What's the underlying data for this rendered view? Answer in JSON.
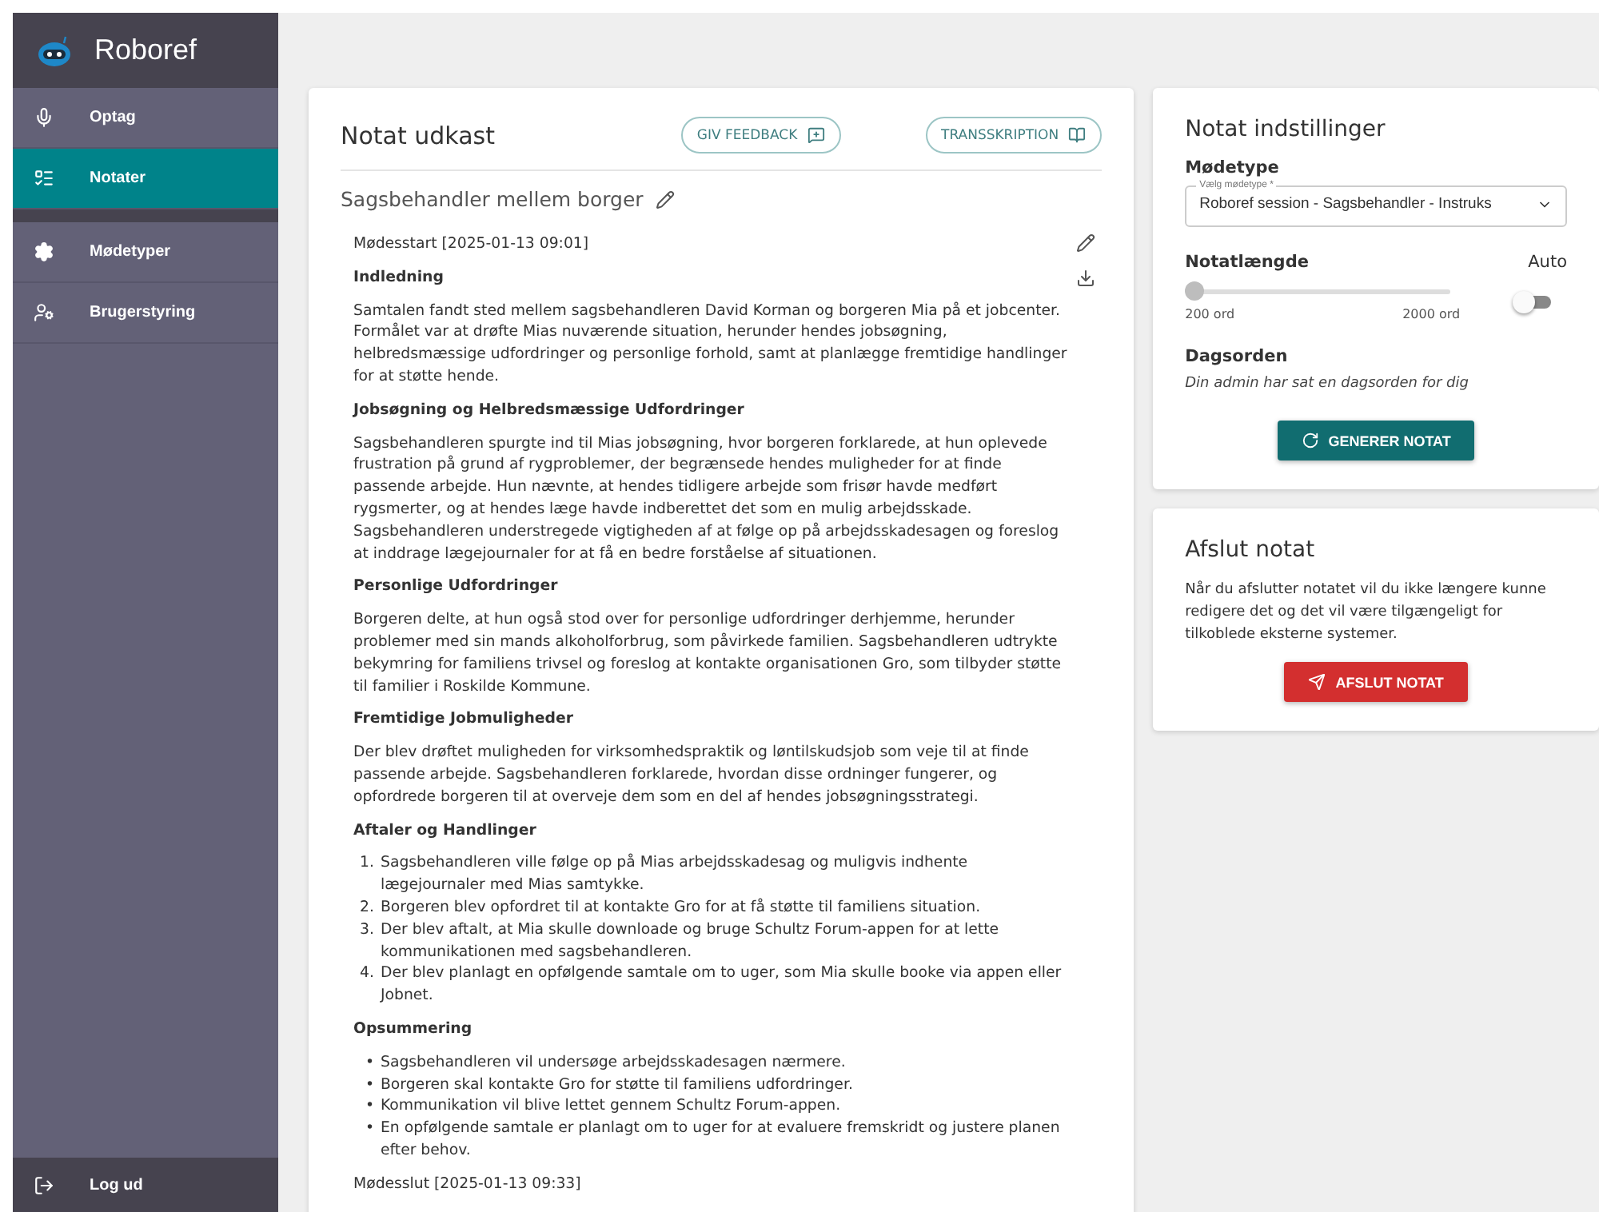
{
  "app": {
    "name": "Roboref"
  },
  "nav": [
    {
      "label": "Optag",
      "selected": false
    },
    {
      "label": "Notater",
      "selected": true
    },
    {
      "label": "Mødetyper",
      "selected": false
    },
    {
      "label": "Brugerstyring",
      "selected": false
    }
  ],
  "logout": {
    "label": "Log ud"
  },
  "note": {
    "title": "Notat udkast",
    "feedback_button": "GIV FEEDBACK",
    "transcript_button": "TRANSSKRIPTION",
    "subtitle": "Sagsbehandler mellem borger",
    "blocks": [
      {
        "kind": "timestamp",
        "text": "Mødesstart [2025-01-13 09:01]"
      },
      {
        "kind": "heading",
        "text": "Indledning"
      },
      {
        "kind": "paragraph",
        "text": "Samtalen fandt sted mellem sagsbehandleren David Korman og borgeren Mia på et jobcenter. Formålet var at drøfte Mias nuværende situation, herunder hendes jobsøgning, helbredsmæssige udfordringer og personlige forhold, samt at planlægge fremtidige handlinger for at støtte hende."
      },
      {
        "kind": "heading",
        "text": "Jobsøgning og Helbredsmæssige Udfordringer"
      },
      {
        "kind": "paragraph",
        "text": "Sagsbehandleren spurgte ind til Mias jobsøgning, hvor borgeren forklarede, at hun oplevede frustration på grund af rygproblemer, der begrænsede hendes muligheder for at finde passende arbejde. Hun nævnte, at hendes tidligere arbejde som frisør havde medført rygsmerter, og at hendes læge havde indberettet det som en mulig arbejdsskade. Sagsbehandleren understregede vigtigheden af at følge op på arbejdsskadesagen og foreslog at inddrage lægejournaler for at få en bedre forståelse af situationen."
      },
      {
        "kind": "heading",
        "text": "Personlige Udfordringer"
      },
      {
        "kind": "paragraph",
        "text": "Borgeren delte, at hun også stod over for personlige udfordringer derhjemme, herunder problemer med sin mands alkoholforbrug, som påvirkede familien. Sagsbehandleren udtrykte bekymring for familiens trivsel og foreslog at kontakte organisationen Gro, som tilbyder støtte til familier i Roskilde Kommune."
      },
      {
        "kind": "heading",
        "text": "Fremtidige Jobmuligheder"
      },
      {
        "kind": "paragraph",
        "text": "Der blev drøftet muligheden for virksomhedspraktik og løntilskudsjob som veje til at finde passende arbejde. Sagsbehandleren forklarede, hvordan disse ordninger fungerer, og opfordrede borgeren til at overveje dem som en del af hendes jobsøgningsstrategi."
      },
      {
        "kind": "heading",
        "text": "Aftaler og Handlinger"
      },
      {
        "kind": "ordered",
        "items": [
          {
            "marker": "1.",
            "text": "Sagsbehandleren ville følge op på Mias arbejdsskadesag og muligvis indhente lægejournaler med Mias samtykke."
          },
          {
            "marker": "2.",
            "text": "Borgeren blev opfordret til at kontakte Gro for at få støtte til familiens situation."
          },
          {
            "marker": "3.",
            "text": "Der blev aftalt, at Mia skulle downloade og bruge Schultz Forum-appen for at lette kommunikationen med sagsbehandleren."
          },
          {
            "marker": "4.",
            "text": "Der blev planlagt en opfølgende samtale om to uger, som Mia skulle booke via appen eller Jobnet."
          }
        ]
      },
      {
        "kind": "heading",
        "text": "Opsummering"
      },
      {
        "kind": "bullets",
        "items": [
          {
            "marker": "•",
            "text": "Sagsbehandleren vil undersøge arbejdsskadesagen nærmere."
          },
          {
            "marker": "•",
            "text": "Borgeren skal kontakte Gro for støtte til familiens udfordringer."
          },
          {
            "marker": "•",
            "text": "Kommunikation vil blive lettet gennem Schultz Forum-appen."
          },
          {
            "marker": "•",
            "text": "En opfølgende samtale er planlagt om to uger for at evaluere fremskridt og justere planen efter behov."
          }
        ]
      },
      {
        "kind": "timestamp",
        "text": "Mødesslut [2025-01-13 09:33]"
      }
    ]
  },
  "settings": {
    "title": "Notat indstillinger",
    "meeting_type_label": "Mødetype",
    "select": {
      "label": "Vælg mødetype *",
      "value": "Roboref session - Sagsbehandler - Instruks"
    },
    "length_label": "Notatlængde",
    "auto_label": "Auto",
    "auto": {
      "on": false
    },
    "slider": {
      "level": 0,
      "min_label": "200 ord",
      "max_label": "2000 ord"
    },
    "agenda_label": "Dagsorden",
    "agenda_text": "Din admin har sat en dagsorden for dig",
    "generate_button": "GENERER NOTAT"
  },
  "finish": {
    "title": "Afslut notat",
    "text": "Når du afslutter notatet vil du ikke længere kunne redigere det og det vil være tilgængeligt for tilkoblede eksterne systemer.",
    "button": "AFSLUT NOTAT"
  }
}
